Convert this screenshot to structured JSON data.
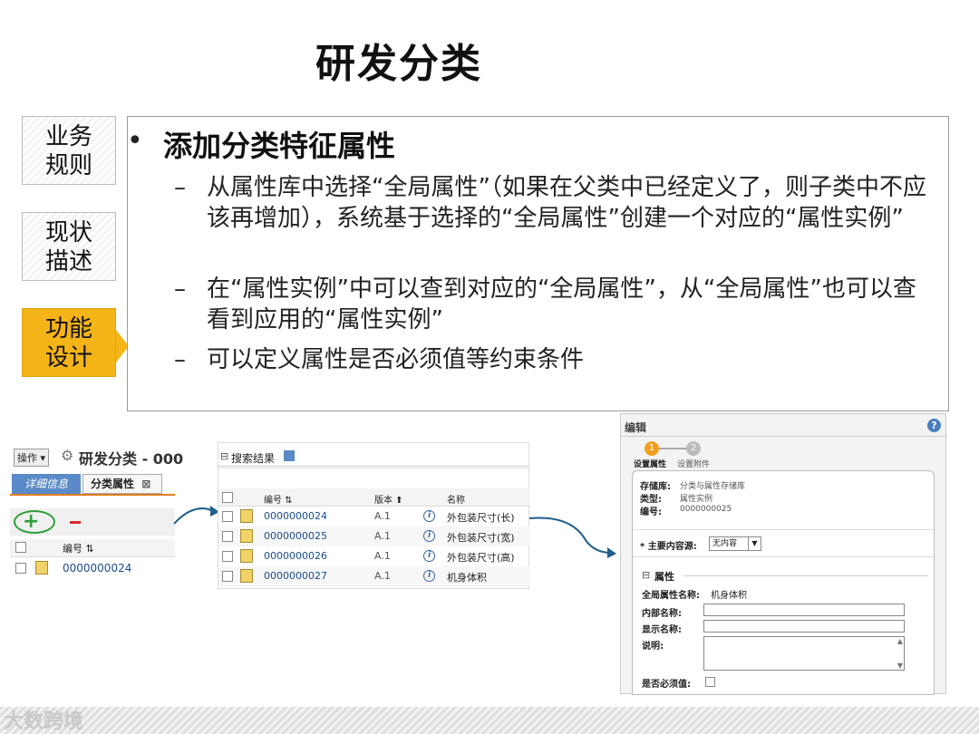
{
  "page": {
    "title": "研发分类"
  },
  "sidebar": {
    "items": [
      {
        "line1": "业务",
        "line2": "规则"
      },
      {
        "line1": "现状",
        "line2": "描述"
      },
      {
        "line1": "功能",
        "line2": "设计"
      }
    ]
  },
  "content": {
    "bullet": "•",
    "heading": "添加分类特征属性",
    "dash": "–",
    "points": [
      "从属性库中选择“全局属性”（如果在父类中已经定义了，则子类中不应该再增加），系统基于选择的“全局属性”创建一个对应的“属性实例”",
      "在“属性实例”中可以查到对应的“全局属性”，从“全局属性”也可以查看到应用的“属性实例”",
      "可以定义属性是否必须值等约束条件"
    ]
  },
  "shot1": {
    "action_menu": "操作 ▾",
    "title": "研发分类 - 000",
    "tab_details": "详细信息",
    "tab_attrs": "分类属性",
    "tab_close": "⊠",
    "col_number": "编号 ⇅",
    "row_number": "0000000024"
  },
  "shot2": {
    "header": "搜索结果",
    "collapse": "⊟",
    "cols": [
      "编号 ⇅",
      "版本 ⬆",
      "名称"
    ],
    "rows": [
      {
        "number": "0000000024",
        "version": "A.1",
        "name": "外包装尺寸(长)"
      },
      {
        "number": "0000000025",
        "version": "A.1",
        "name": "外包装尺寸(宽)"
      },
      {
        "number": "0000000026",
        "version": "A.1",
        "name": "外包装尺寸(高)"
      },
      {
        "number": "0000000027",
        "version": "A.1",
        "name": "机身体积"
      }
    ]
  },
  "shot3": {
    "header": "编辑",
    "help": "?",
    "step1_num": "1",
    "step2_num": "2",
    "step1": "设置属性",
    "step2": "设置附件",
    "store_label": "存储库:",
    "store_value": "分类与属性存储库",
    "type_label": "类型:",
    "type_value": "属性实例",
    "num_label": "编号:",
    "num_value": "0000000025",
    "source_label": "* 主要内容源:",
    "source_value": "无内容",
    "section": "属性",
    "section_toggle": "⊟",
    "global_name_label": "全局属性名称:",
    "global_name_value": "机身体积",
    "internal_label": "内部名称:",
    "display_label": "显示名称:",
    "desc_label": "说明:",
    "required_label": "是否必须值:"
  },
  "footer": {
    "watermark": "大数跨境"
  },
  "colors": {
    "active_tab": "#f5b417",
    "link": "#1a4c8a",
    "arrow": "#1f5f8b"
  }
}
